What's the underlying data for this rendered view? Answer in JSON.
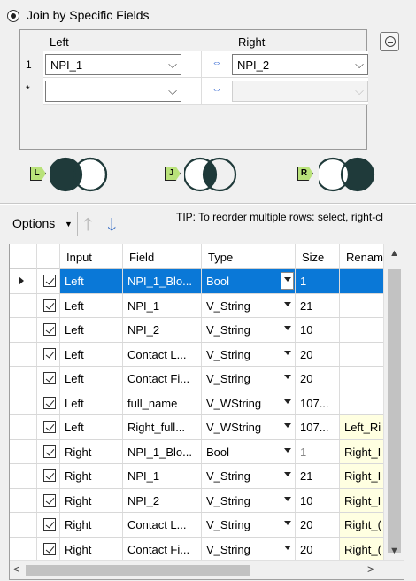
{
  "join_mode": {
    "label": "Join by Specific Fields"
  },
  "join_grid": {
    "header_left": "Left",
    "header_right": "Right",
    "rows": [
      {
        "num": "1",
        "left": "NPI_1",
        "right": "NPI_2"
      },
      {
        "num": "*",
        "left": "",
        "right": ""
      }
    ],
    "link_glyph": "⇔"
  },
  "join_outputs": [
    {
      "tag": "L",
      "name": "left-join"
    },
    {
      "tag": "J",
      "name": "inner-join"
    },
    {
      "tag": "R",
      "name": "right-join"
    }
  ],
  "toolbar": {
    "options_label": "Options",
    "tip": "TIP: To reorder multiple rows: select, right-cl"
  },
  "table": {
    "columns": [
      "Input",
      "Field",
      "Type",
      "Size",
      "Renam"
    ],
    "rows": [
      {
        "input": "Left",
        "field": "NPI_1_Blo...",
        "type": "Bool",
        "size": "1",
        "rename": "",
        "selected": true
      },
      {
        "input": "Left",
        "field": "NPI_1",
        "type": "V_String",
        "size": "21",
        "rename": ""
      },
      {
        "input": "Left",
        "field": "NPI_2",
        "type": "V_String",
        "size": "10",
        "rename": ""
      },
      {
        "input": "Left",
        "field": "Contact L...",
        "type": "V_String",
        "size": "20",
        "rename": ""
      },
      {
        "input": "Left",
        "field": "Contact Fi...",
        "type": "V_String",
        "size": "20",
        "rename": ""
      },
      {
        "input": "Left",
        "field": "full_name",
        "type": "V_WString",
        "size": "107...",
        "rename": ""
      },
      {
        "input": "Left",
        "field": "Right_full...",
        "type": "V_WString",
        "size": "107...",
        "rename": "Left_Ri"
      },
      {
        "input": "Right",
        "field": "NPI_1_Blo...",
        "type": "Bool",
        "size": "1",
        "rename": "Right_I"
      },
      {
        "input": "Right",
        "field": "NPI_1",
        "type": "V_String",
        "size": "21",
        "rename": "Right_I"
      },
      {
        "input": "Right",
        "field": "NPI_2",
        "type": "V_String",
        "size": "10",
        "rename": "Right_I"
      },
      {
        "input": "Right",
        "field": "Contact L...",
        "type": "V_String",
        "size": "20",
        "rename": "Right_("
      },
      {
        "input": "Right",
        "field": "Contact Fi...",
        "type": "V_String",
        "size": "20",
        "rename": "Right_("
      }
    ]
  }
}
